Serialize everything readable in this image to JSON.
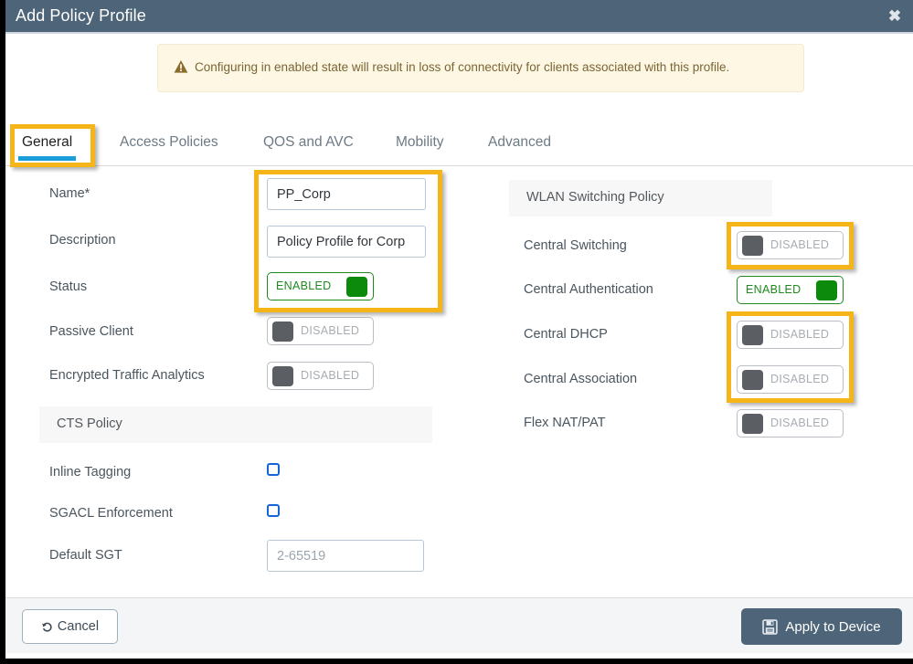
{
  "dialog": {
    "title": "Add Policy Profile",
    "close_icon": "close-icon"
  },
  "warning": {
    "icon": "warning-triangle-icon",
    "text": "Configuring in enabled state will result in loss of connectivity for clients associated with this profile."
  },
  "tabs": [
    {
      "label": "General",
      "active": true
    },
    {
      "label": "Access Policies",
      "active": false
    },
    {
      "label": "QOS and AVC",
      "active": false
    },
    {
      "label": "Mobility",
      "active": false
    },
    {
      "label": "Advanced",
      "active": false
    }
  ],
  "left_column": {
    "name": {
      "label": "Name*",
      "value": "PP_Corp"
    },
    "description": {
      "label": "Description",
      "value": "Policy Profile for Corp"
    },
    "status": {
      "label": "Status",
      "state": "ENABLED"
    },
    "passive_client": {
      "label": "Passive Client",
      "state": "DISABLED"
    },
    "encrypted_traffic_analytics": {
      "label": "Encrypted Traffic Analytics",
      "state": "DISABLED"
    },
    "cts_policy": {
      "section_title": "CTS Policy",
      "inline_tagging": {
        "label": "Inline Tagging",
        "checked": false
      },
      "sgacl_enforcement": {
        "label": "SGACL Enforcement",
        "checked": false
      },
      "default_sgt": {
        "label": "Default SGT",
        "placeholder": "2-65519",
        "value": ""
      }
    }
  },
  "right_column": {
    "section_title": "WLAN Switching Policy",
    "rows": [
      {
        "label": "Central Switching",
        "state": "DISABLED"
      },
      {
        "label": "Central Authentication",
        "state": "ENABLED"
      },
      {
        "label": "Central DHCP",
        "state": "DISABLED"
      },
      {
        "label": "Central Association",
        "state": "DISABLED"
      },
      {
        "label": "Flex NAT/PAT",
        "state": "DISABLED"
      }
    ]
  },
  "footer": {
    "cancel_label": "Cancel",
    "cancel_icon": "undo-arrow-icon",
    "apply_label": "Apply to Device",
    "apply_icon": "save-floppy-icon"
  },
  "colors": {
    "titlebar": "#4e6579",
    "accent_blue": "#1b9dd9",
    "highlight_yellow": "#f5b417",
    "enabled_green": "#0b8a0b",
    "warning_bg": "#fdf7e3",
    "warning_text": "#7a6535"
  }
}
